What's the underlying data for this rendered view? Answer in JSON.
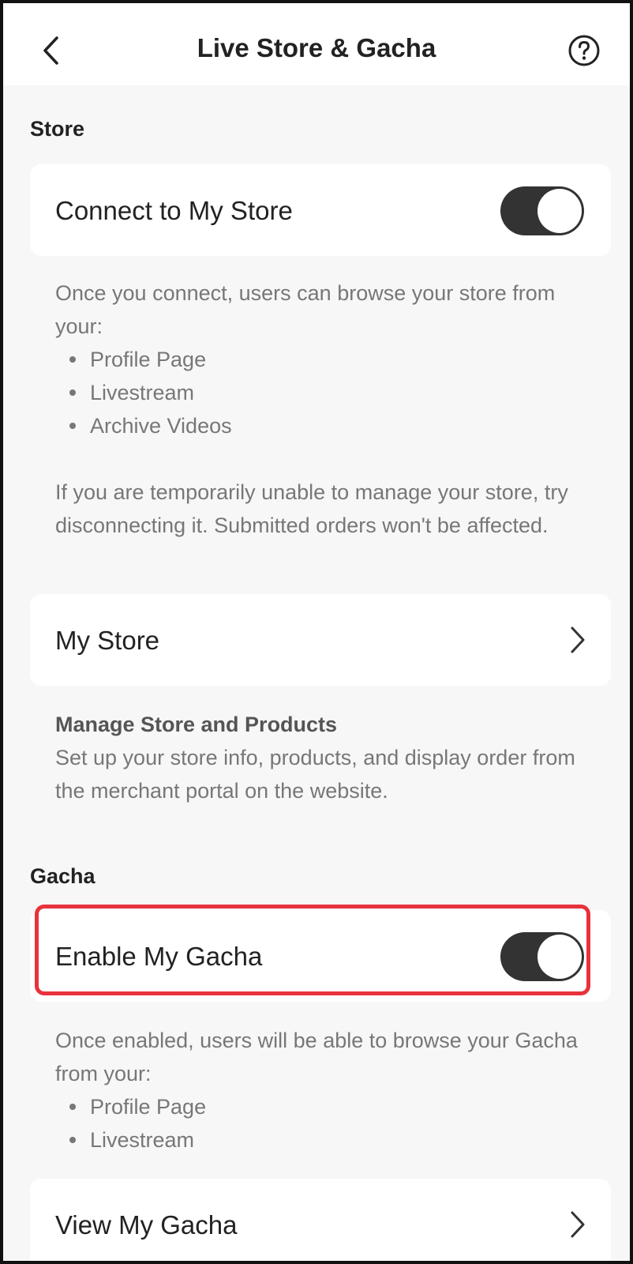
{
  "header": {
    "title": "Live Store & Gacha",
    "back_icon": "chevron-left-icon",
    "help_icon": "question-circle-icon"
  },
  "store": {
    "section_label": "Store",
    "connect_label": "Connect to My Store",
    "connect_enabled": true,
    "connect_desc": "Once you connect, users can browse your store from your:",
    "connect_bullets": [
      "Profile Page",
      "Livestream",
      "Archive Videos"
    ],
    "disconnect_note": "If you are temporarily unable to manage your store, try disconnecting it. Submitted orders won't be affected.",
    "my_store_label": "My Store",
    "manage_title": "Manage Store and Products",
    "manage_desc": "Set up your store info, products, and display order from the merchant portal on the website."
  },
  "gacha": {
    "section_label": "Gacha",
    "enable_label": "Enable My Gacha",
    "enable_enabled": true,
    "enable_desc": "Once enabled, users will be able to browse your Gacha from your:",
    "enable_bullets": [
      "Profile Page",
      "Livestream"
    ],
    "view_label": "View My Gacha"
  },
  "colors": {
    "highlight": "#e8323c",
    "toggle_on": "#333333",
    "background": "#f7f7f7"
  }
}
